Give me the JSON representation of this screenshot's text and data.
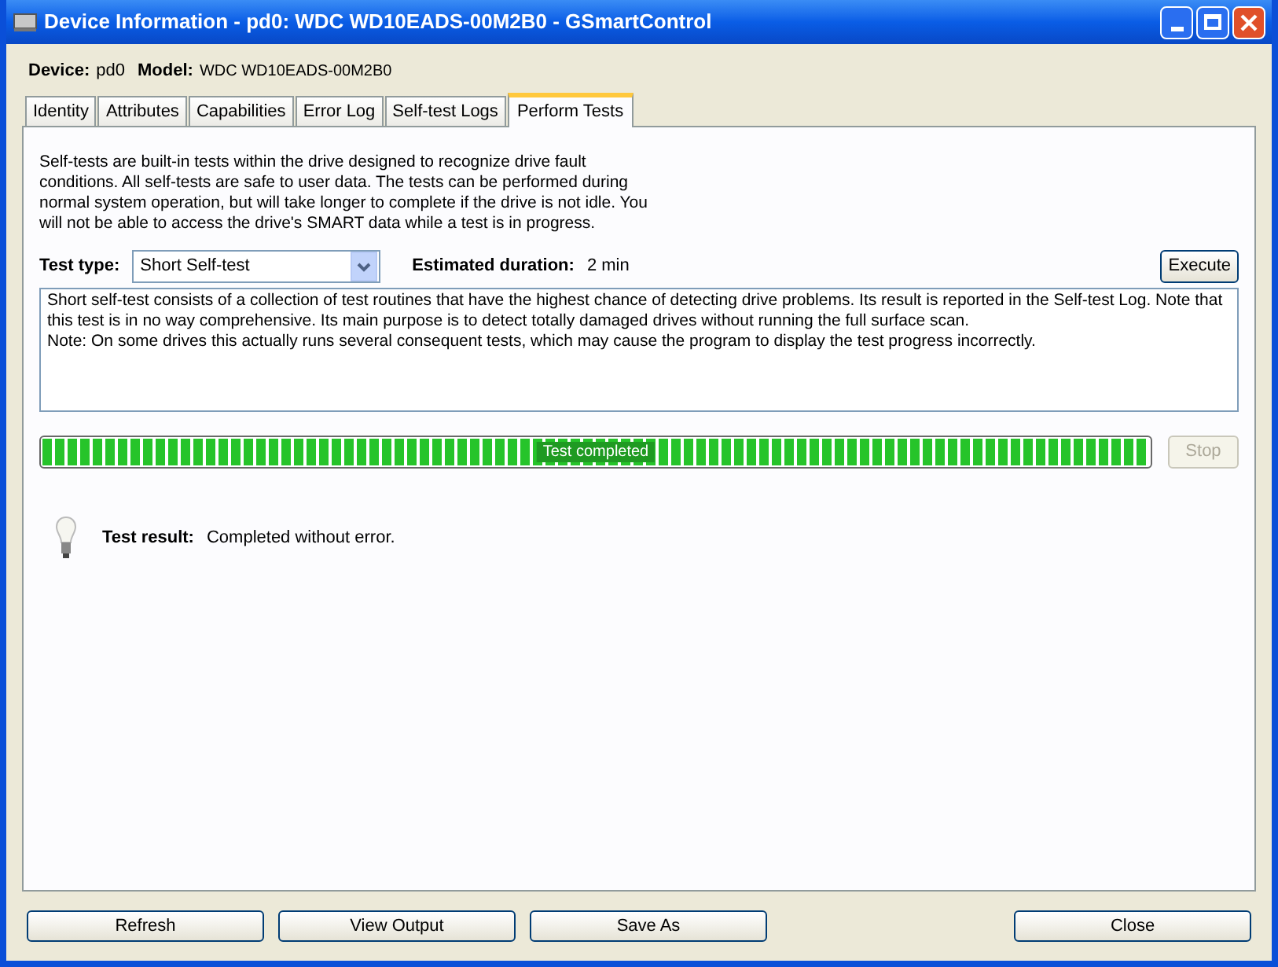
{
  "window": {
    "title": "Device Information - pd0: WDC WD10EADS-00M2B0 - GSmartControl"
  },
  "device_info": {
    "device_label": "Device:",
    "device": "pd0",
    "model_label": "Model:",
    "model": "WDC WD10EADS-00M2B0"
  },
  "tabs": [
    {
      "label": "Identity",
      "selected": false
    },
    {
      "label": "Attributes",
      "selected": false
    },
    {
      "label": "Capabilities",
      "selected": false
    },
    {
      "label": "Error Log",
      "selected": false
    },
    {
      "label": "Self-test Logs",
      "selected": false
    },
    {
      "label": "Perform Tests",
      "selected": true
    }
  ],
  "intro": "Self-tests are built-in tests within the drive designed to recognize drive fault conditions. All self-tests are safe to user data. The tests can be performed during normal system operation, but will take longer to complete if the drive is not idle. You will not be able to access the drive's SMART data while a test is in progress.",
  "test_type": {
    "label": "Test type:",
    "value": "Short Self-test"
  },
  "duration": {
    "label": "Estimated duration:",
    "value": "2 min"
  },
  "execute_button": {
    "label": "Execute",
    "disabled": false
  },
  "description": "Short self-test consists of a collection of test routines that have the highest chance of detecting drive problems. Its result is reported in the Self-test Log. Note that this test is in no way comprehensive. Its main purpose is to detect totally damaged drives without running the full surface scan.\nNote: On some drives this actually runs several consequent tests, which may cause the program to display the test progress incorrectly.",
  "progress": {
    "level": 1,
    "text": "Test completed"
  },
  "stop_button": {
    "label": "Stop",
    "disabled": true
  },
  "result": {
    "label": "Test result:",
    "value": "Completed without error."
  },
  "buttons": [
    {
      "label": "Refresh"
    },
    {
      "label": "View Output"
    },
    {
      "label": "Save As"
    },
    {
      "label": "Close"
    }
  ]
}
